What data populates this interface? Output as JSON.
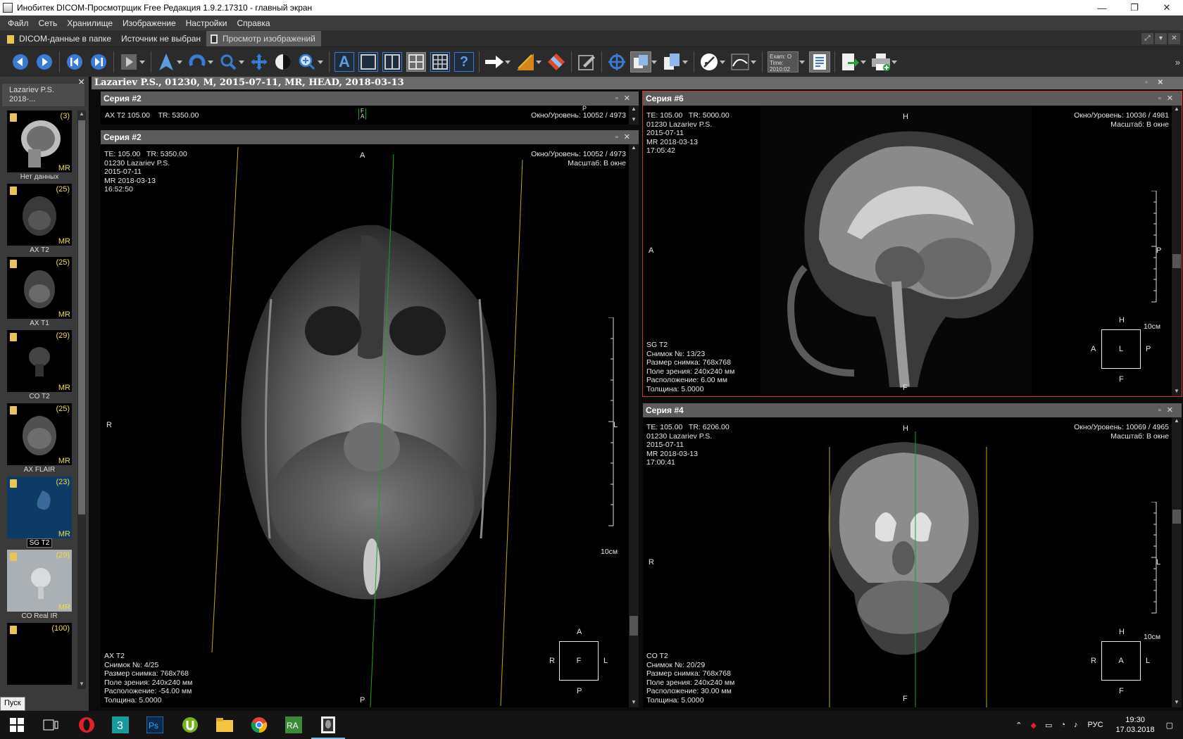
{
  "window": {
    "title": "Инобитек DICOM-Просмотрщик Free Редакция 1.9.2.17310 - главный экран",
    "minimize": "—",
    "maximize": "❐",
    "close": "✕"
  },
  "menu": [
    "Файл",
    "Сеть",
    "Хранилище",
    "Изображение",
    "Настройки",
    "Справка"
  ],
  "tabs": [
    {
      "label": "DICOM-данные в папке",
      "active": false
    },
    {
      "label": "Источник не выбран",
      "active": false
    },
    {
      "label": "Просмотр изображений",
      "active": true
    }
  ],
  "toolbar": {
    "exam_time_label": "Exam: O Time: 2010:02",
    "icons": [
      "prev-icon",
      "next-icon",
      "prev-series-icon",
      "next-series-icon",
      "play-icon",
      "pointer-icon",
      "rotate-icon",
      "zoom-icon",
      "pan-icon",
      "window-level-icon",
      "magnifier-icon",
      "annotation-text-icon",
      "layout-1x1-icon",
      "layout-1x2-icon",
      "layout-2x2-icon",
      "layout-3x3-icon",
      "help-icon",
      "arrow-icon",
      "ruler-icon",
      "eraser-icon",
      "edit-icon",
      "crosshair-icon",
      "sync-icon",
      "copy-icon",
      "measure-icon",
      "curve-icon",
      "exam-time-icon",
      "report-icon",
      "export-icon",
      "print-icon"
    ]
  },
  "sidebar": {
    "patient_card": "Lazariev P.S.\n2018-...",
    "series": [
      {
        "count": "(3)",
        "modality": "MR",
        "label": "Нет данных"
      },
      {
        "count": "(25)",
        "modality": "MR",
        "label": "AX T2"
      },
      {
        "count": "(25)",
        "modality": "MR",
        "label": "AX T1"
      },
      {
        "count": "(29)",
        "modality": "MR",
        "label": "CO T2"
      },
      {
        "count": "(25)",
        "modality": "MR",
        "label": "AX FLAIR"
      },
      {
        "count": "(23)",
        "modality": "MR",
        "label": "SG T2"
      },
      {
        "count": "(29)",
        "modality": "MR",
        "label": "CO Real IR"
      },
      {
        "count": "(100)",
        "modality": "",
        "label": ""
      }
    ],
    "close": "✕"
  },
  "patient_header": "Lazariev P.S., 01230, M, 2015-07-11, MR, HEAD, 2018-03-13",
  "panels": {
    "small": {
      "title": "Серия #2",
      "left": "AX T2 105.00    TR: 5350.00",
      "right": "Окно/Уровень: 10052 / 4973",
      "orient_mid": "F\nA",
      "orient_top": "P"
    },
    "main": {
      "title": "Серия #2",
      "top_left": "TE: 105.00   TR: 5350.00\n01230 Lazariev P.S.\n2015-07-11\nMR 2018-03-13\n16:52:50",
      "top_right": "Окно/Уровень: 10052 / 4973\nМасштаб: В окне",
      "bottom_left": "AX T2\nСнимок №: 4/25\nРазмер снимка: 768x768\nПоле зрения: 240x240 мм\nРасположение: -54.00 мм\nТолщина: 5.0000",
      "orient": {
        "top": "A",
        "bottom": "P",
        "left": "R",
        "right": "L"
      },
      "scale": "10см",
      "cube": {
        "center": "F",
        "top": "A",
        "bottom": "P",
        "left": "R",
        "right": "L"
      }
    },
    "sag": {
      "title": "Серия #6",
      "top_left": "TE: 105.00   TR: 5000.00\n01230 Lazariev P.S.\n2015-07-11\nMR 2018-03-13\n17:05:42",
      "top_right": "Окно/Уровень: 10036 / 4981\nМасштаб: В окне",
      "bottom_left": "SG T2\nСнимок №: 13/23\nРазмер снимка: 768x768\nПоле зрения: 240x240 мм\nРасположение: 6.00 мм\nТолщина: 5.0000",
      "orient": {
        "top": "H",
        "bottom": "F",
        "left": "A",
        "right": "P"
      },
      "scale": "10см",
      "cube": {
        "center": "L",
        "top": "H",
        "bottom": "F",
        "left": "A",
        "right": "P"
      }
    },
    "cor": {
      "title": "Серия #4",
      "top_left": "TE: 105.00   TR: 6206.00\n01230 Lazariev P.S.\n2015-07-11\nMR 2018-03-13\n17:00:41",
      "top_right": "Окно/Уровень: 10069 / 4965\nМасштаб: В окне",
      "bottom_left": "CO T2\nСнимок №: 20/29\nРазмер снимка: 768x768\nПоле зрения: 240x240 мм\nРасположение: 30.00 мм\nТолщина: 5.0000",
      "orient": {
        "top": "H",
        "bottom": "F",
        "left": "R",
        "right": "L"
      },
      "scale": "10см",
      "cube": {
        "center": "A",
        "top": "H",
        "bottom": "F",
        "left": "R",
        "right": "L"
      }
    }
  },
  "taskbar": {
    "start_tip": "Пуск",
    "lang": "РУС",
    "time": "19:30",
    "date": "17.03.2018"
  },
  "colors": {
    "accent_blue": "#3a7bd5",
    "overlay_text": "#e6e6e6",
    "count_yellow": "#f0dc44",
    "active_border": "#d43030",
    "ref_line_yellow": "#b8b000",
    "ref_line_green": "#1aa31a"
  }
}
